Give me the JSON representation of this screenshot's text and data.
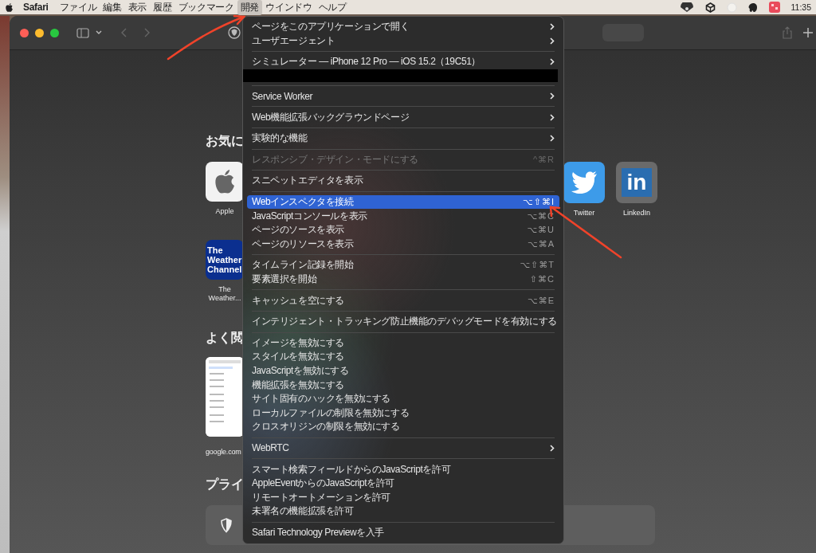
{
  "menubar": {
    "app_name": "Safari",
    "items": [
      {
        "label": "ファイル",
        "selected": false
      },
      {
        "label": "編集",
        "selected": false
      },
      {
        "label": "表示",
        "selected": false
      },
      {
        "label": "履歴",
        "selected": false
      },
      {
        "label": "ブックマーク",
        "selected": false
      },
      {
        "label": "開発",
        "selected": true
      },
      {
        "label": "ウインドウ",
        "selected": false
      },
      {
        "label": "ヘルプ",
        "selected": false
      }
    ],
    "clock": "11:35"
  },
  "favorites": {
    "heading": "お気に",
    "rows": [
      [
        {
          "kind": "apple",
          "label": "Apple"
        },
        {
          "kind": "twitter",
          "label": "Twitter"
        },
        {
          "kind": "linkedin",
          "logo_text": "in",
          "label": "LinkedIn"
        }
      ],
      [
        {
          "kind": "weather",
          "logo_text": "The Weather Channel",
          "label": "The Weather..."
        }
      ]
    ]
  },
  "frequently_visited": {
    "heading": "よく閲",
    "tiles": [
      {
        "label": "google.com"
      }
    ]
  },
  "privacy": {
    "heading": "プライ"
  },
  "menu": {
    "items": [
      {
        "kind": "item",
        "label": "ページをこのアプリケーションで開く",
        "submenu": true,
        "disabled": false,
        "selected": false
      },
      {
        "kind": "item",
        "label": "ユーザエージェント",
        "submenu": true,
        "disabled": false,
        "selected": false
      },
      {
        "kind": "separator"
      },
      {
        "kind": "item",
        "label": "シミュレーター — iPhone 12 Pro — iOS 15.2（19C51）",
        "submenu": true,
        "disabled": false,
        "selected": false
      },
      {
        "kind": "redacted"
      },
      {
        "kind": "separator"
      },
      {
        "kind": "item",
        "label": "Service Worker",
        "submenu": true,
        "disabled": false,
        "selected": false
      },
      {
        "kind": "separator"
      },
      {
        "kind": "item",
        "label": "Web機能拡張バックグラウンドページ",
        "submenu": true,
        "disabled": false,
        "selected": false
      },
      {
        "kind": "separator"
      },
      {
        "kind": "item",
        "label": "実験的な機能",
        "submenu": true,
        "disabled": false,
        "selected": false
      },
      {
        "kind": "separator"
      },
      {
        "kind": "item",
        "label": "レスポンシブ・デザイン・モードにする",
        "shortcut": "^⌘R",
        "submenu": false,
        "disabled": true,
        "selected": false
      },
      {
        "kind": "separator"
      },
      {
        "kind": "item",
        "label": "スニペットエディタを表示",
        "submenu": false,
        "disabled": false,
        "selected": false
      },
      {
        "kind": "separator"
      },
      {
        "kind": "item",
        "label": "Webインスペクタを接続",
        "shortcut": "⌥⇧⌘I",
        "submenu": false,
        "disabled": false,
        "selected": true
      },
      {
        "kind": "item",
        "label": "JavaScriptコンソールを表示",
        "shortcut": "⌥⌘C",
        "submenu": false,
        "disabled": false,
        "selected": false
      },
      {
        "kind": "item",
        "label": "ページのソースを表示",
        "shortcut": "⌥⌘U",
        "submenu": false,
        "disabled": false,
        "selected": false
      },
      {
        "kind": "item",
        "label": "ページのリソースを表示",
        "shortcut": "⌥⌘A",
        "submenu": false,
        "disabled": false,
        "selected": false
      },
      {
        "kind": "separator"
      },
      {
        "kind": "item",
        "label": "タイムライン記録を開始",
        "shortcut": "⌥⇧⌘T",
        "submenu": false,
        "disabled": false,
        "selected": false
      },
      {
        "kind": "item",
        "label": "要素選択を開始",
        "shortcut": "⇧⌘C",
        "submenu": false,
        "disabled": false,
        "selected": false
      },
      {
        "kind": "separator"
      },
      {
        "kind": "item",
        "label": "キャッシュを空にする",
        "shortcut": "⌥⌘E",
        "submenu": false,
        "disabled": false,
        "selected": false
      },
      {
        "kind": "separator"
      },
      {
        "kind": "item",
        "label": "インテリジェント・トラッキング防止機能のデバッグモードを有効にする",
        "submenu": false,
        "disabled": false,
        "selected": false
      },
      {
        "kind": "separator"
      },
      {
        "kind": "item",
        "label": "イメージを無効にする",
        "submenu": false,
        "disabled": false,
        "selected": false
      },
      {
        "kind": "item",
        "label": "スタイルを無効にする",
        "submenu": false,
        "disabled": false,
        "selected": false
      },
      {
        "kind": "item",
        "label": "JavaScriptを無効にする",
        "submenu": false,
        "disabled": false,
        "selected": false
      },
      {
        "kind": "item",
        "label": "機能拡張を無効にする",
        "submenu": false,
        "disabled": false,
        "selected": false
      },
      {
        "kind": "item",
        "label": "サイト固有のハックを無効にする",
        "submenu": false,
        "disabled": false,
        "selected": false
      },
      {
        "kind": "item",
        "label": "ローカルファイルの制限を無効にする",
        "submenu": false,
        "disabled": false,
        "selected": false
      },
      {
        "kind": "item",
        "label": "クロスオリジンの制限を無効にする",
        "submenu": false,
        "disabled": false,
        "selected": false
      },
      {
        "kind": "separator"
      },
      {
        "kind": "item",
        "label": "WebRTC",
        "submenu": true,
        "disabled": false,
        "selected": false
      },
      {
        "kind": "separator"
      },
      {
        "kind": "item",
        "label": "スマート検索フィールドからのJavaScriptを許可",
        "submenu": false,
        "disabled": false,
        "selected": false
      },
      {
        "kind": "item",
        "label": "AppleEventからのJavaScriptを許可",
        "submenu": false,
        "disabled": false,
        "selected": false
      },
      {
        "kind": "item",
        "label": "リモートオートメーションを許可",
        "submenu": false,
        "disabled": false,
        "selected": false
      },
      {
        "kind": "item",
        "label": "未署名の機能拡張を許可",
        "submenu": false,
        "disabled": false,
        "selected": false
      },
      {
        "kind": "separator"
      },
      {
        "kind": "item",
        "label": "Safari Technology Previewを入手",
        "submenu": false,
        "disabled": false,
        "selected": false
      }
    ]
  }
}
